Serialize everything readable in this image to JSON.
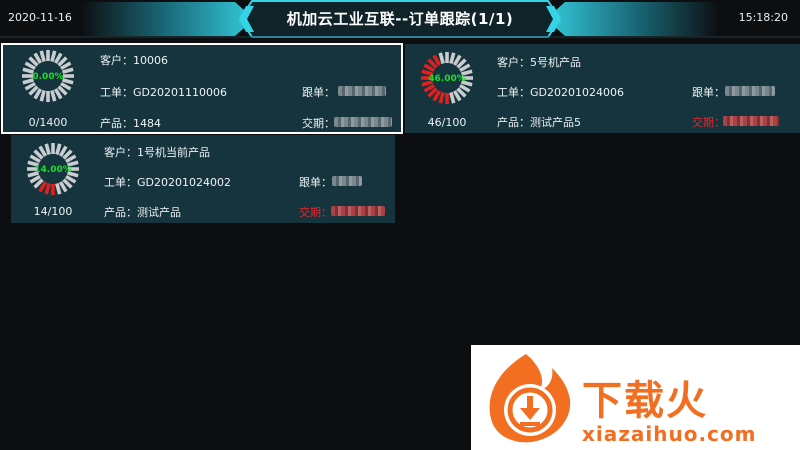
{
  "header": {
    "date": "2020-11-16",
    "title": "机加云工业互联--订单跟踪(1/1)",
    "time": "15:18:20"
  },
  "labels": {
    "customer": "客户：",
    "work_order": "工单：",
    "product": "产品：",
    "follow": "跟单：",
    "due": "交期："
  },
  "orders": [
    {
      "customer": "10006",
      "work_order": "GD20201110006",
      "product": "1484",
      "count": "0/1400",
      "progress_text": "0.00%",
      "progress": 0.0,
      "due_overdue": false,
      "selected": true
    },
    {
      "customer": "5号机产品",
      "work_order": "GD20201024006",
      "product": "测试产品5",
      "count": "46/100",
      "progress_text": "46.00%",
      "progress": 0.46,
      "due_overdue": true,
      "selected": false
    },
    {
      "customer": "1号机当前产品",
      "work_order": "GD20201024002",
      "product": "测试产品",
      "count": "14/100",
      "progress_text": "14.00%",
      "progress": 0.14,
      "due_overdue": true,
      "selected": false
    }
  ],
  "colors": {
    "gauge_done": "#e0201e",
    "gauge_todo": "#c9cdd0",
    "pct_text": "#19e028",
    "card_bg": "#15343d",
    "accent": "#35d3e6",
    "overdue": "#e8282a"
  },
  "watermark": {
    "brand": "下载火",
    "url": "xiazaihuo.com"
  }
}
